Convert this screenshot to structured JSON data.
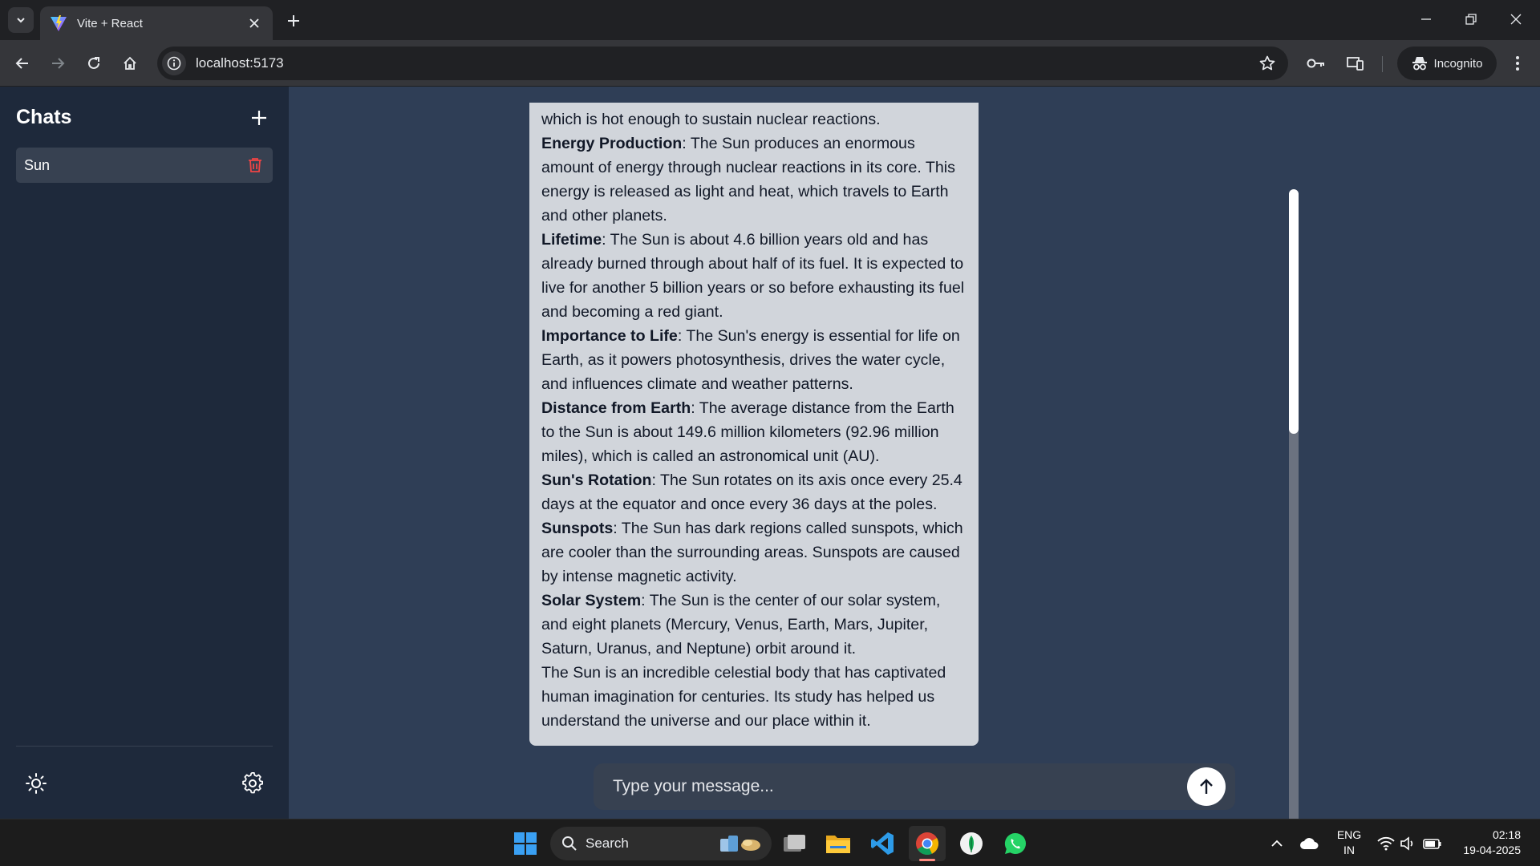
{
  "browser": {
    "tab_title": "Vite + React",
    "url": "localhost:5173",
    "incognito_label": "Incognito"
  },
  "sidebar": {
    "title": "Chats",
    "chats": [
      {
        "label": "Sun"
      }
    ]
  },
  "message": {
    "intro": "which is hot enough to sustain nuclear reactions.",
    "sections": [
      {
        "heading": "Energy Production",
        "text": ": The Sun produces an enormous amount of energy through nuclear reactions in its core. This energy is released as light and heat, which travels to Earth and other planets."
      },
      {
        "heading": "Lifetime",
        "text": ": The Sun is about 4.6 billion years old and has already burned through about half of its fuel. It is expected to live for another 5 billion years or so before exhausting its fuel and becoming a red giant."
      },
      {
        "heading": "Importance to Life",
        "text": ": The Sun's energy is essential for life on Earth, as it powers photosynthesis, drives the water cycle, and influences climate and weather patterns."
      },
      {
        "heading": "Distance from Earth",
        "text": ": The average distance from the Earth to the Sun is about 149.6 million kilometers (92.96 million miles), which is called an astronomical unit (AU)."
      },
      {
        "heading": "Sun's Rotation",
        "text": ": The Sun rotates on its axis once every 25.4 days at the equator and once every 36 days at the poles."
      },
      {
        "heading": "Sunspots",
        "text": ": The Sun has dark regions called sunspots, which are cooler than the surrounding areas. Sunspots are caused by intense magnetic activity."
      },
      {
        "heading": "Solar System",
        "text": ": The Sun is the center of our solar system, and eight planets (Mercury, Venus, Earth, Mars, Jupiter, Saturn, Uranus, and Neptune) orbit around it."
      }
    ],
    "conclusion": "The Sun is an incredible celestial body that has captivated human imagination for centuries. Its study has helped us understand the universe and our place within it."
  },
  "composer": {
    "placeholder": "Type your message..."
  },
  "taskbar": {
    "search_label": "Search",
    "lang_line1": "ENG",
    "lang_line2": "IN",
    "time": "02:18",
    "date": "19-04-2025"
  },
  "colors": {
    "sidebar_bg": "#1e293b",
    "main_bg": "#2f3e56",
    "bubble_bg": "#d1d5db",
    "delete_icon": "#ef4444"
  }
}
